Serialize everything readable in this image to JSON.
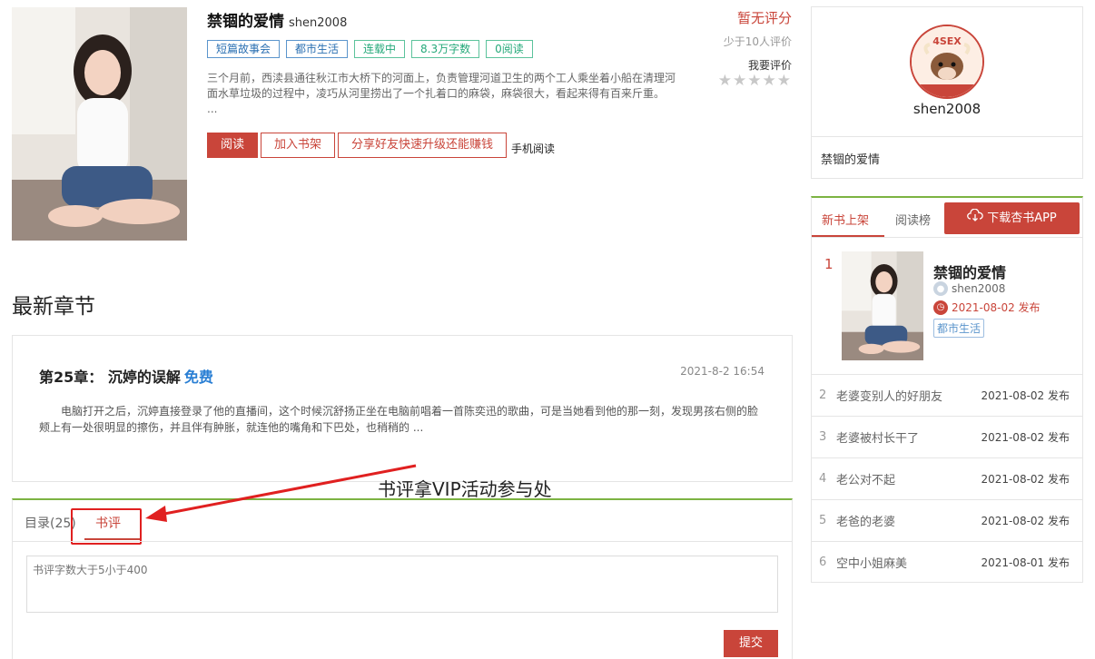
{
  "book": {
    "title": "禁锢的爱情",
    "author": "shen2008",
    "tags": [
      {
        "label": "短篇故事会",
        "color": "blue"
      },
      {
        "label": "都市生活",
        "color": "blue"
      },
      {
        "label": "连载中",
        "color": "green"
      },
      {
        "label": "8.3万字数",
        "color": "green"
      },
      {
        "label": "0阅读",
        "color": "green"
      }
    ],
    "intro": "三个月前，西渎县通往秋江市大桥下的河面上，负责管理河道卫生的两个工人乘坐着小船在清理河面水草垃圾的过程中，凌巧从河里捞出了一个扎着口的麻袋，麻袋很大，看起来得有百来斤重。",
    "intro_more": "...",
    "read_button": "阅读",
    "shelf_button": "加入书架",
    "share_button": "分享好友快速升级还能赚钱",
    "mobile_read": "手机阅读"
  },
  "rating": {
    "score": "暂无评分",
    "note": "少于10人评价",
    "rate_label": "我要评价",
    "stars": "★★★★★"
  },
  "latest": {
    "section_title": "最新章节",
    "chapter_title": "第25章： 沉婷的误解",
    "free_label": "免费",
    "time": "2021-8-2 16:54",
    "excerpt": "电脑打开之后，沉婷直接登录了他的直播间，这个时候沉舒扬正坐在电脑前唱着一首陈奕迅的歌曲，可是当她看到他的那一刻，发现男孩右侧的脸颊上有一处很明显的擦伤，并且伴有肿胀，就连他的嘴角和下巴处，也稍稍的 ..."
  },
  "annotation": {
    "text": "书评拿VIP活动参与处"
  },
  "tabs": {
    "catalog": "目录(25)",
    "review": "书评",
    "review_placeholder": "书评字数大于5小于400",
    "submit": "提交"
  },
  "profile": {
    "name": "shen2008",
    "book": "禁锢的爱情"
  },
  "ranking": {
    "tab_new": "新书上架",
    "tab_read": "阅读榜",
    "download": "下载杏书APP",
    "top": {
      "rank": "1",
      "title": "禁锢的爱情",
      "author": "shen2008",
      "date": "2021-08-02 发布",
      "tag": "都市生活"
    },
    "items": [
      {
        "rank": "2",
        "title": "老婆变别人的好朋友",
        "date": "2021-08-02 发布"
      },
      {
        "rank": "3",
        "title": "老婆被村长干了",
        "date": "2021-08-02 发布"
      },
      {
        "rank": "4",
        "title": "老公对不起",
        "date": "2021-08-02 发布"
      },
      {
        "rank": "5",
        "title": "老爸的老婆",
        "date": "2021-08-02 发布"
      },
      {
        "rank": "6",
        "title": "空中小姐麻美",
        "date": "2021-08-01 发布"
      }
    ]
  },
  "colors": {
    "accent": "#c9453a",
    "green_line": "#7cb342",
    "link_blue": "#2a7fd4"
  }
}
